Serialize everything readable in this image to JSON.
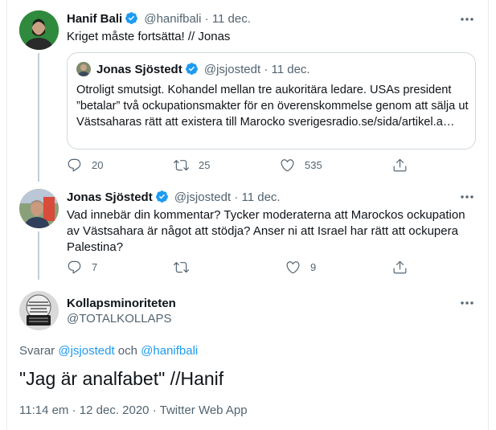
{
  "tweet1": {
    "name": "Hanif Bali",
    "handle": "@hanifbali",
    "date": "11 dec.",
    "text": "Kriget måste fortsätta! // Jonas",
    "quote": {
      "name": "Jonas Sjöstedt",
      "handle": "@jsjostedt",
      "date": "11 dec.",
      "text": "Otroligt smutsigt. Kohandel mellan tre aukoritära ledare. USAs president ”betalar” två ockupationsmakter för en överenskommelse genom att sälja ut Västsaharas rätt att existera till Marocko sverigesradio.se/sida/artikel.a…"
    },
    "replies": "20",
    "retweets": "25",
    "likes": "535"
  },
  "tweet2": {
    "name": "Jonas Sjöstedt",
    "handle": "@jsjostedt",
    "date": "11 dec.",
    "text": "Vad innebär din kommentar? Tycker moderaterna att Marockos ockupation av Västsahara är något att stödja? Anser ni att Israel har rätt att ockupera Palestina?",
    "replies": "7",
    "likes": "9"
  },
  "main_tweet": {
    "name": "Kollapsminoriteten",
    "handle": "@TOTALKOLLAPS",
    "replying_prefix": "Svarar",
    "reply_to_1": "@jsjostedt",
    "reply_and": "och",
    "reply_to_2": "@hanifbali",
    "text": "\"Jag är analfabet\" //Hanif",
    "time": "11:14 em",
    "date": "12 dec. 2020",
    "source": "Twitter Web App"
  },
  "colors": {
    "accent": "#1d9bf0",
    "muted": "#536471",
    "border": "#cfd9de"
  },
  "separator": "·"
}
